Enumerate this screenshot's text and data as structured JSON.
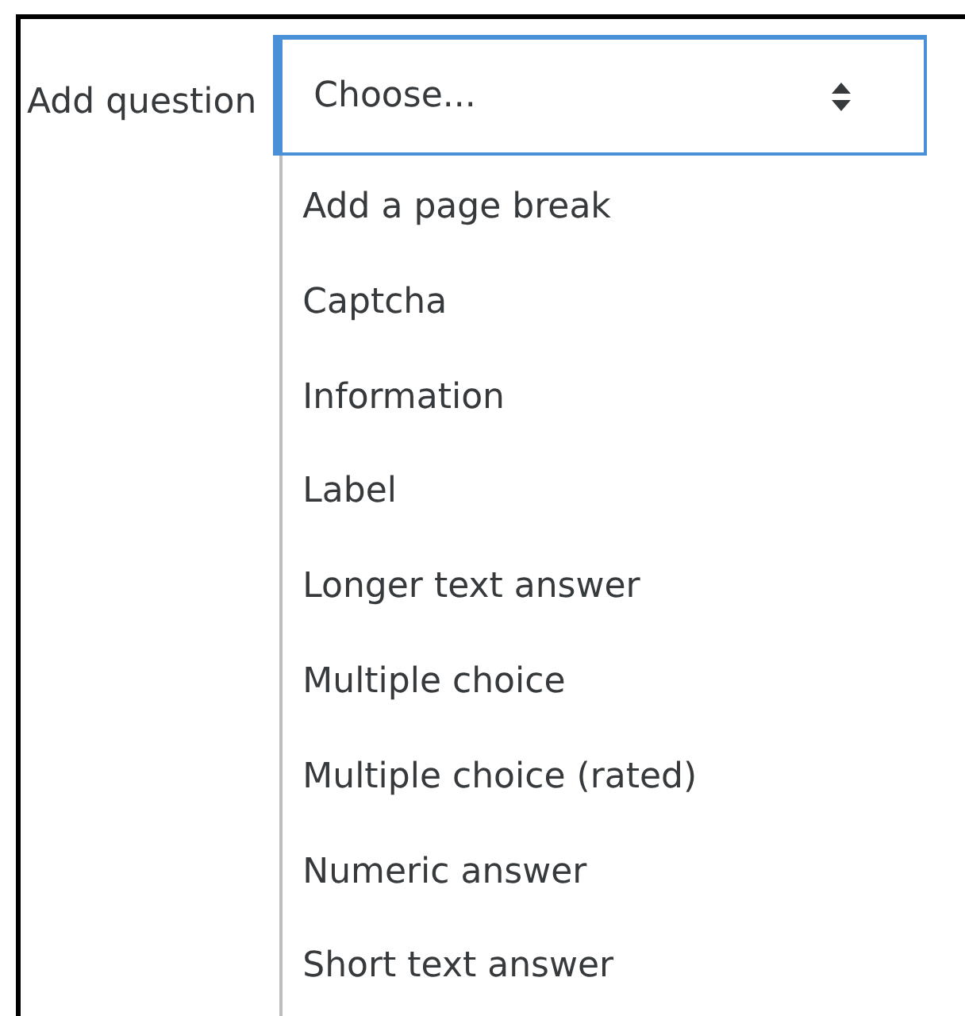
{
  "question_select": {
    "label": "Add question",
    "value": "Choose...",
    "expanded": true,
    "options": [
      "Add a page break",
      "Captcha",
      "Information",
      "Label",
      "Longer text answer",
      "Multiple choice",
      "Multiple choice (rated)",
      "Numeric answer",
      "Short text answer"
    ]
  }
}
